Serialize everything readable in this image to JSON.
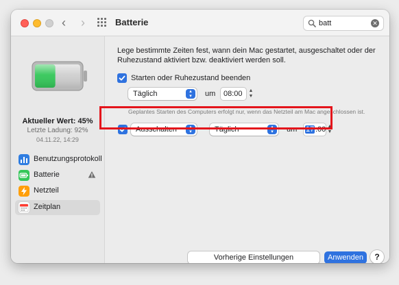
{
  "window": {
    "title": "Batterie",
    "search_value": "batt"
  },
  "sidebar": {
    "current_value": "Aktueller Wert: 45%",
    "last_charge": "Letzte Ladung: 92%",
    "last_charge_date": "04.11.22, 14:29",
    "battery_level_percent": 45,
    "items": [
      {
        "label": "Benutzungsprotokoll",
        "icon": "bar-chart-icon",
        "color": "#2f7de1"
      },
      {
        "label": "Batterie",
        "icon": "battery-icon",
        "color": "#34c759",
        "warning": true
      },
      {
        "label": "Netzteil",
        "icon": "lightning-icon",
        "color": "#ff9f0a"
      },
      {
        "label": "Zeitplan",
        "icon": "calendar-icon",
        "color": "#ffffff",
        "active": true
      }
    ]
  },
  "content": {
    "intro": "Lege bestimmte Zeiten fest, wann dein Mac gestartet, ausgeschaltet oder der Ruhezustand aktiviert bzw. deaktiviert werden soll.",
    "row1": {
      "checked": true,
      "label": "Starten oder Ruhezustand beenden",
      "frequency": "Täglich",
      "um_label": "um",
      "time": "08:00"
    },
    "note": "Geplantes Starten des Computers erfolgt nur, wenn das Netzteil am Mac angeschlossen ist.",
    "row2": {
      "checked": true,
      "action": "Ausschalten",
      "frequency": "Täglich",
      "um_label": "um",
      "time_hour": "17",
      "time_rest": ":00"
    }
  },
  "buttons": {
    "restore": "Vorherige Einstellungen wiederherstellen",
    "apply": "Anwenden",
    "help": "?"
  },
  "colors": {
    "accent": "#2f72df",
    "highlight": "#e4141b",
    "battery_green": "#34c759"
  }
}
